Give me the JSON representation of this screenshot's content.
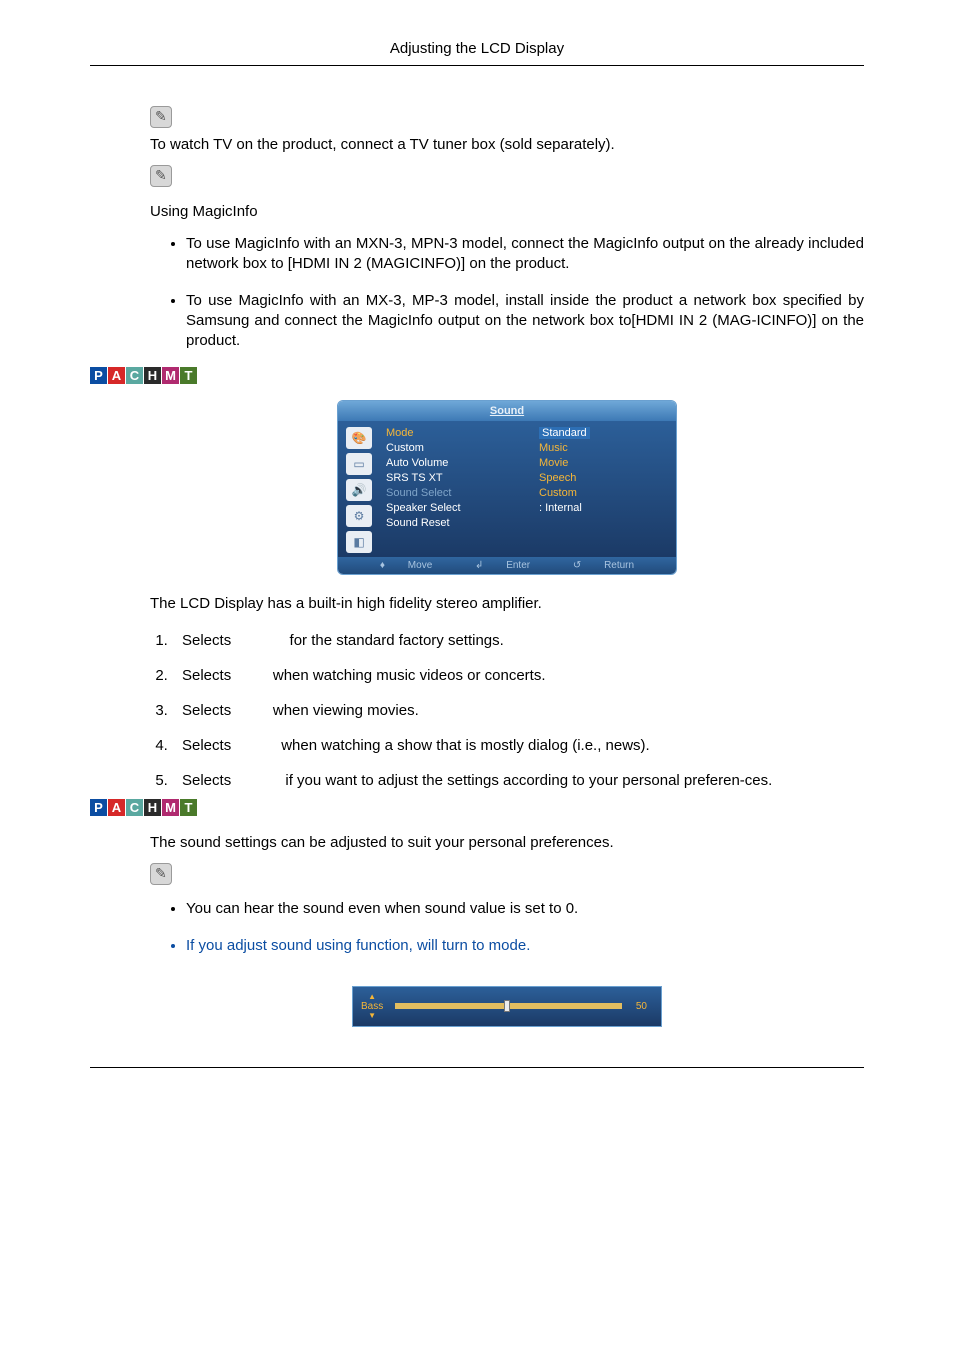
{
  "header": {
    "title": "Adjusting the LCD Display"
  },
  "icons": {
    "note": "note-icon"
  },
  "intro": {
    "tv_note": "To watch TV on the product, connect a TV tuner box (sold separately).",
    "magic_heading": "Using MagicInfo",
    "magic_bullets": [
      "To use MagicInfo with an MXN-3, MPN-3 model, connect the MagicInfo output on the already included network box to [HDMI IN 2 (MAGICINFO)] on the product.",
      "To use MagicInfo with an MX-3, MP-3 model, install inside the product a network box specified by Samsung and connect the MagicInfo output on the network box to[HDMI IN 2 (MAG-ICINFO)] on the product."
    ]
  },
  "mode_badges_1": [
    "P",
    "A",
    "C",
    "H",
    "M",
    "T"
  ],
  "mode_badges_2": [
    "P",
    "A",
    "C",
    "H",
    "M",
    "T"
  ],
  "osd": {
    "title": "Sound",
    "left_items": [
      "Mode",
      "Custom",
      "Auto Volume",
      "SRS TS XT",
      "Sound Select",
      "Speaker Select",
      "Sound Reset"
    ],
    "right_items": [
      "Standard",
      "Music",
      "Movie",
      "Speech",
      "Custom",
      ": Internal"
    ],
    "footer": {
      "move": "Move",
      "enter": "Enter",
      "return": "Return"
    }
  },
  "amp_line": "The LCD Display has a built-in high fidelity stereo amplifier.",
  "list": [
    {
      "prefix": "Selects ",
      "suffix": " for the standard factory settings."
    },
    {
      "prefix": "Selects ",
      "suffix": " when watching music videos or concerts."
    },
    {
      "prefix": "Selects ",
      "suffix": " when viewing movies."
    },
    {
      "prefix": "Selects ",
      "suffix": " when watching a show that is mostly dialog (i.e., news)."
    },
    {
      "prefix": "Selects ",
      "suffix": " if you want to adjust the settings according to your personal preferen-ces."
    }
  ],
  "custom_section": {
    "intro": "The sound settings can be adjusted to suit your personal preferences.",
    "bullets": [
      "You can hear the sound even when sound value is set to 0.",
      "If you adjust sound using           function,         will turn to            mode."
    ]
  },
  "slider": {
    "label": "Bass",
    "value": "50"
  }
}
